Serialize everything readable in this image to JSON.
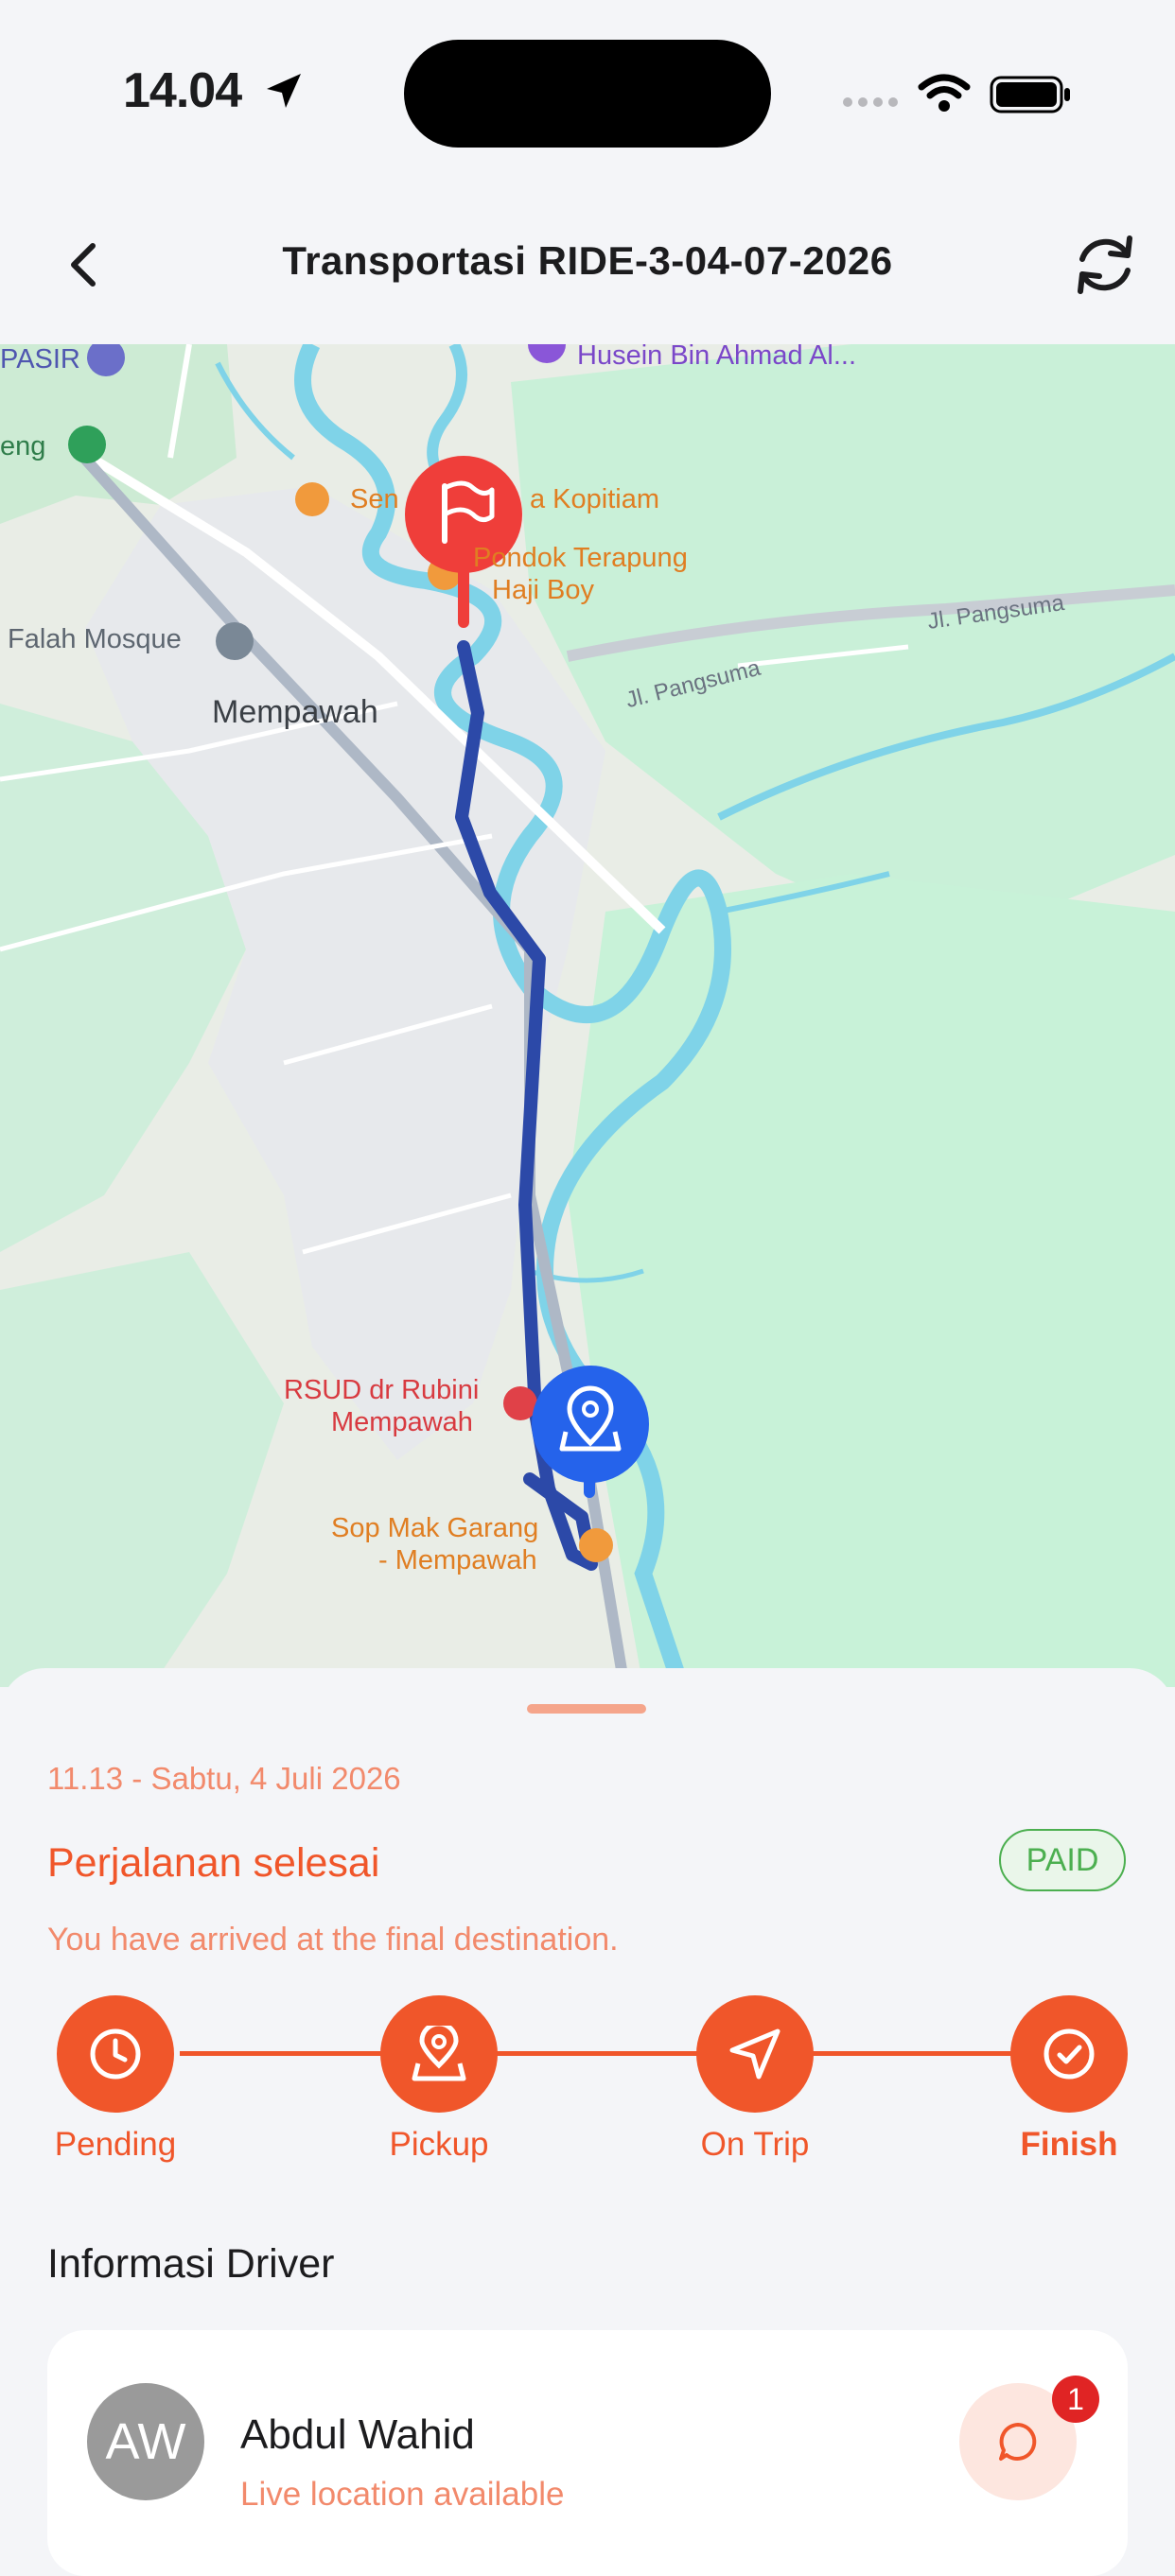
{
  "status_bar": {
    "time": "14.04"
  },
  "header": {
    "title": "Transportasi RIDE-3-04-07-2026"
  },
  "map": {
    "labels": {
      "pasir": "PASIR",
      "eng": "eng",
      "husein": "Husein Bin Ahmad Al...",
      "kopitiam_a": "Sen",
      "kopitiam_b": "a Kopitiam",
      "pondok_1": "Pondok Terapung",
      "pondok_2": "Haji Boy",
      "pangsuma_1": "Jl. Pangsuma",
      "pangsuma_2": "Jl. Pangsuma",
      "falah": "Falah Mosque",
      "mempawah": "Mempawah",
      "rsud_1": "RSUD dr Rubini",
      "rsud_2": "Mempawah",
      "sop_1": "Sop Mak Garang",
      "sop_2": "- Mempawah"
    },
    "markers": {
      "destination": "flag-icon",
      "origin": "map-pin-icon"
    },
    "route_color": "#2c49a8"
  },
  "trip": {
    "datetime": "11.13 - Sabtu, 4 Juli 2026",
    "status_title": "Perjalanan selesai",
    "payment_badge": "PAID",
    "status_desc": "You have arrived at the final destination.",
    "steps": [
      {
        "label": "Pending",
        "icon": "clock-icon"
      },
      {
        "label": "Pickup",
        "icon": "map-pin-icon"
      },
      {
        "label": "On Trip",
        "icon": "navigation-arrow-icon"
      },
      {
        "label": "Finish",
        "icon": "check-circle-icon"
      }
    ],
    "active_step": "Finish"
  },
  "driver": {
    "section_title": "Informasi Driver",
    "initials": "AW",
    "name": "Abdul Wahid",
    "subtitle": "Live location available",
    "unread_count": "1"
  },
  "colors": {
    "accent": "#f0562a",
    "accent_light": "#f28a6c",
    "paid": "#4caf50",
    "origin_marker": "#2563eb",
    "destination_marker": "#ef3e3a"
  }
}
